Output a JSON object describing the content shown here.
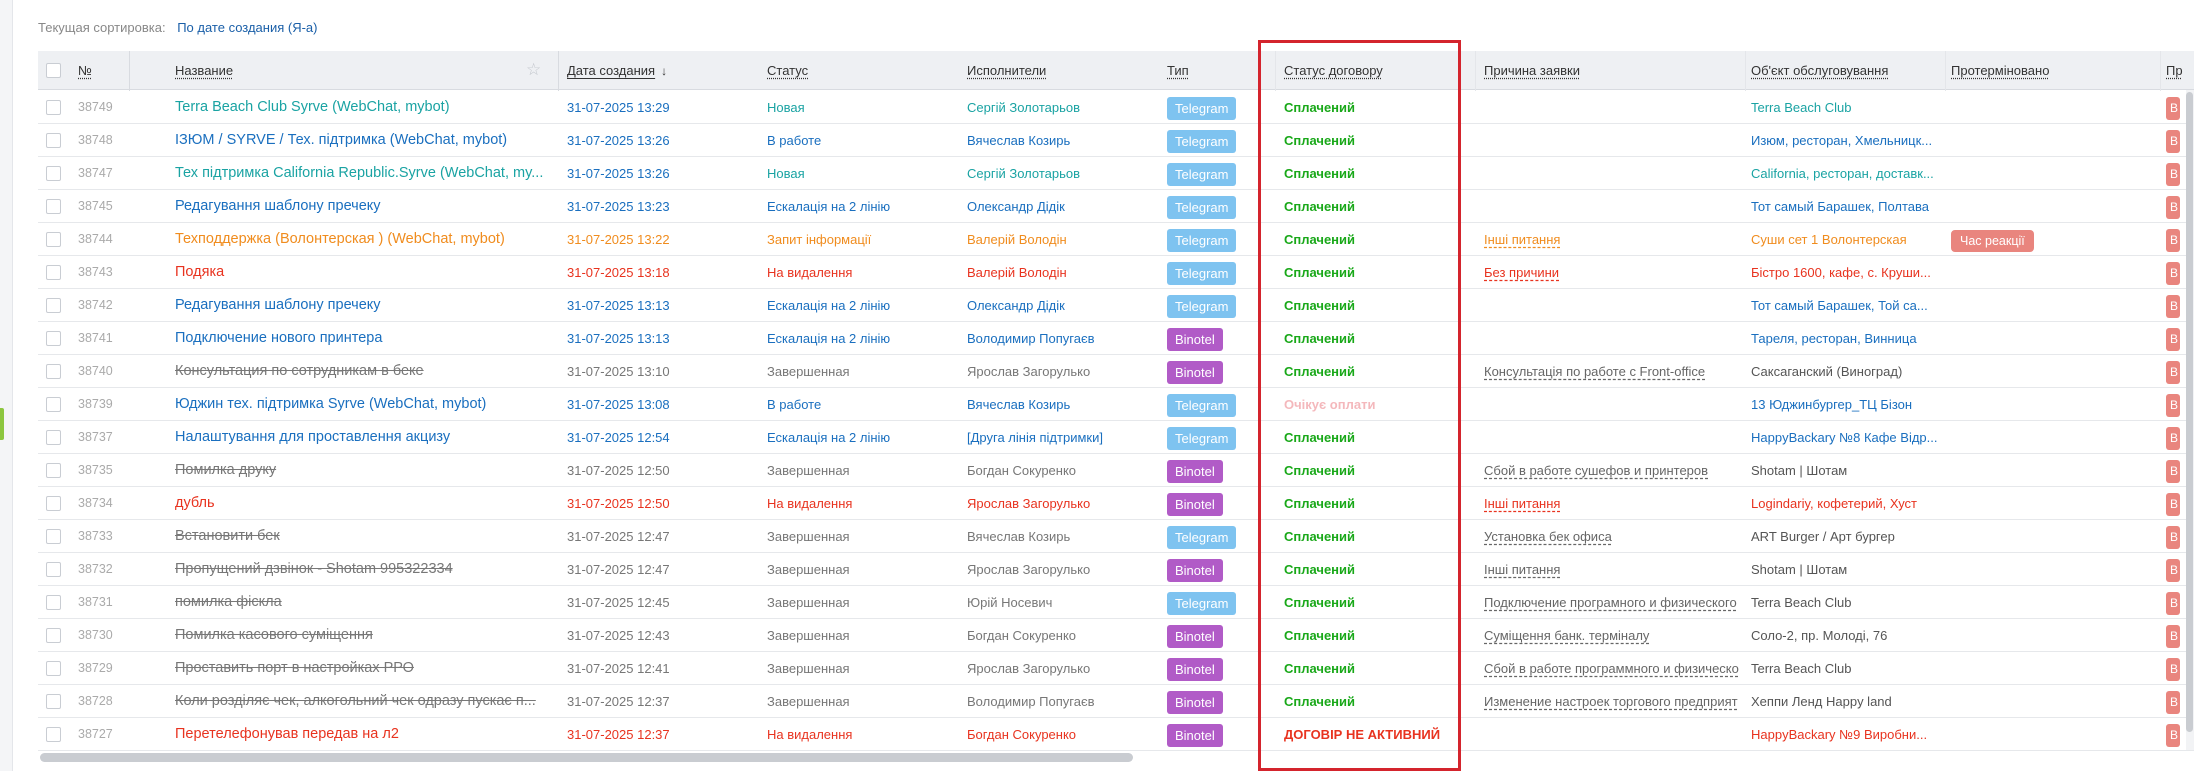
{
  "sort": {
    "label": "Текущая сортировка:",
    "value": "По дате создания (Я-а)"
  },
  "columns": {
    "num": "№",
    "title": "Название",
    "date": "Дата создания",
    "status": "Статус",
    "executors": "Исполнители",
    "type": "Тип",
    "contract": "Статус договору",
    "reason": "Причина заявки",
    "object": "Об'єкт обслуговування",
    "overdue": "Протерміновано",
    "extra": "Пр"
  },
  "colors": {
    "telegram": "#7ec3f0",
    "binotel": "#b15bc7",
    "green": "#19a819",
    "orange": "#f08c1e",
    "red": "#e8331f",
    "teal": "#1aa3a3",
    "blue": "#1a6fbf",
    "gray": "#777777",
    "pending": "#f4b8bc",
    "highlight": "#d4242d"
  },
  "rows": [
    {
      "num": "38749",
      "title": "Terra Beach Club Syrve (WebChat, mybot)",
      "date": "31-07-2025 13:29",
      "status": "Новая",
      "exec": "Сергій Золотарьов",
      "type": "Telegram",
      "contract": "Сплачений",
      "reason": "",
      "object": "Terra Beach Club",
      "overdue": "",
      "tone": "teal",
      "strike": false,
      "contractTone": "green"
    },
    {
      "num": "38748",
      "title": "ІЗЮМ / SYRVE / Тех. підтримка (WebChat, mybot)",
      "date": "31-07-2025 13:26",
      "status": "В работе",
      "exec": "Вячеслав Козирь",
      "type": "Telegram",
      "contract": "Сплачений",
      "reason": "",
      "object": "Изюм, ресторан, Хмельницк...",
      "overdue": "",
      "tone": "blue",
      "strike": false,
      "contractTone": "green"
    },
    {
      "num": "38747",
      "title": "Тех підтримка California Republic.Syrve (WebChat, my...",
      "date": "31-07-2025 13:26",
      "status": "Новая",
      "exec": "Сергій Золотарьов",
      "type": "Telegram",
      "contract": "Сплачений",
      "reason": "",
      "object": "California, ресторан, доставк...",
      "overdue": "",
      "tone": "teal",
      "strike": false,
      "contractTone": "green"
    },
    {
      "num": "38745",
      "title": "Редагування шаблону пречеку",
      "date": "31-07-2025 13:23",
      "status": "Ескалація на 2 лінію",
      "exec": "Олександр Дідік",
      "type": "Telegram",
      "contract": "Сплачений",
      "reason": "",
      "object": "Тот самый Барашек, Полтава",
      "overdue": "",
      "tone": "blue",
      "strike": false,
      "contractTone": "green"
    },
    {
      "num": "38744",
      "title": "Техподдержка (Волонтерская ) (WebChat, mybot)",
      "date": "31-07-2025 13:22",
      "status": "Запит інформації",
      "exec": "Валерій Володін",
      "type": "Telegram",
      "contract": "Сплачений",
      "reason": "Інші питання",
      "object": "Суши сет 1 Волонтерская",
      "overdue": "Час реакції",
      "tone": "orange",
      "strike": false,
      "contractTone": "green"
    },
    {
      "num": "38743",
      "title": "Подяка",
      "date": "31-07-2025 13:18",
      "status": "На видалення",
      "exec": "Валерій Володін",
      "type": "Telegram",
      "contract": "Сплачений",
      "reason": "Без причини",
      "object": "Бістро 1600, кафе, с. Круши...",
      "overdue": "",
      "tone": "red",
      "strike": false,
      "contractTone": "green"
    },
    {
      "num": "38742",
      "title": "Редагування шаблону пречеку",
      "date": "31-07-2025 13:13",
      "status": "Ескалація на 2 лінію",
      "exec": "Олександр Дідік",
      "type": "Telegram",
      "contract": "Сплачений",
      "reason": "",
      "object": "Тот самый Барашек, Той са...",
      "overdue": "",
      "tone": "blue",
      "strike": false,
      "contractTone": "green"
    },
    {
      "num": "38741",
      "title": "Подключение нового принтера",
      "date": "31-07-2025 13:13",
      "status": "Ескалація на 2 лінію",
      "exec": "Володимир Попугаєв",
      "type": "Binotel",
      "contract": "Сплачений",
      "reason": "",
      "object": "Тареля, ресторан, Винница",
      "overdue": "",
      "tone": "blue",
      "strike": false,
      "contractTone": "green"
    },
    {
      "num": "38740",
      "title": "Консультация по сотрудникам в беке",
      "date": "31-07-2025 13:10",
      "status": "Завершенная",
      "exec": "Ярослав Загорулько",
      "type": "Binotel",
      "contract": "Сплачений",
      "reason": "Консультація по работе с Front-office",
      "object": "Саксаганский (Виноград)",
      "overdue": "",
      "tone": "gray",
      "strike": true,
      "contractTone": "green"
    },
    {
      "num": "38739",
      "title": "Юджин тех. підтримка Syrve (WebChat, mybot)",
      "date": "31-07-2025 13:08",
      "status": "В работе",
      "exec": "Вячеслав Козирь",
      "type": "Telegram",
      "contract": "Очікує оплати",
      "reason": "",
      "object": "13 Юджинбургер_ТЦ Бізон",
      "overdue": "",
      "tone": "blue",
      "strike": false,
      "contractTone": "pending"
    },
    {
      "num": "38737",
      "title": "Налаштування для проставлення акцизу",
      "date": "31-07-2025 12:54",
      "status": "Ескалація на 2 лінію",
      "exec": "[Друга лінія підтримки]",
      "type": "Telegram",
      "contract": "Сплачений",
      "reason": "",
      "object": "HappyBackary №8 Кафе Відр...",
      "overdue": "",
      "tone": "blue",
      "strike": false,
      "contractTone": "green"
    },
    {
      "num": "38735",
      "title": "Помилка друку",
      "date": "31-07-2025 12:50",
      "status": "Завершенная",
      "exec": "Богдан Сокуренко",
      "type": "Binotel",
      "contract": "Сплачений",
      "reason": "Сбой в работе сушефов и принтеров",
      "object": "Shotam | Шотам",
      "overdue": "",
      "tone": "gray",
      "strike": true,
      "contractTone": "green"
    },
    {
      "num": "38734",
      "title": "дубль",
      "date": "31-07-2025 12:50",
      "status": "На видалення",
      "exec": "Ярослав Загорулько",
      "type": "Binotel",
      "contract": "Сплачений",
      "reason": "Інші питання",
      "object": "Logindariy, кофетерий, Хуст",
      "overdue": "",
      "tone": "red",
      "strike": false,
      "contractTone": "green"
    },
    {
      "num": "38733",
      "title": "Встановити бек",
      "date": "31-07-2025 12:47",
      "status": "Завершенная",
      "exec": "Вячеслав Козирь",
      "type": "Telegram",
      "contract": "Сплачений",
      "reason": "Установка бек офиса",
      "object": "ART Burger / Арт бургер",
      "overdue": "",
      "tone": "gray",
      "strike": true,
      "contractTone": "green"
    },
    {
      "num": "38732",
      "title": "Пропущений дзвінок - Shotam 995322334",
      "date": "31-07-2025 12:47",
      "status": "Завершенная",
      "exec": "Ярослав Загорулько",
      "type": "Binotel",
      "contract": "Сплачений",
      "reason": "Інші питання",
      "object": "Shotam | Шотам",
      "overdue": "",
      "tone": "gray",
      "strike": true,
      "contractTone": "green"
    },
    {
      "num": "38731",
      "title": "помилка фіскла",
      "date": "31-07-2025 12:45",
      "status": "Завершенная",
      "exec": "Юрій Носевич",
      "type": "Telegram",
      "contract": "Сплачений",
      "reason": "Подключение програмного и физического",
      "object": "Terra Beach Club",
      "overdue": "",
      "tone": "gray",
      "strike": true,
      "contractTone": "green"
    },
    {
      "num": "38730",
      "title": "Помилка касового суміщення",
      "date": "31-07-2025 12:43",
      "status": "Завершенная",
      "exec": "Богдан Сокуренко",
      "type": "Binotel",
      "contract": "Сплачений",
      "reason": "Суміщення банк. терміналу",
      "object": "Соло-2, пр. Молоді, 76",
      "overdue": "",
      "tone": "gray",
      "strike": true,
      "contractTone": "green"
    },
    {
      "num": "38729",
      "title": "Проставить порт в настройках РРО",
      "date": "31-07-2025 12:41",
      "status": "Завершенная",
      "exec": "Ярослав Загорулько",
      "type": "Binotel",
      "contract": "Сплачений",
      "reason": "Сбой в работе программного и физическо",
      "object": "Terra Beach Club",
      "overdue": "",
      "tone": "gray",
      "strike": true,
      "contractTone": "green"
    },
    {
      "num": "38728",
      "title": "Коли розділяє чек, алкогольний чек одразу пускає п...",
      "date": "31-07-2025 12:37",
      "status": "Завершенная",
      "exec": "Володимир Попугаєв",
      "type": "Binotel",
      "contract": "Сплачений",
      "reason": "Изменение настроек торгового предприят",
      "object": "Хеппи Ленд Happy land",
      "overdue": "",
      "tone": "gray",
      "strike": true,
      "contractTone": "green"
    },
    {
      "num": "38727",
      "title": "Перетелефонував передав на л2",
      "date": "31-07-2025 12:37",
      "status": "На видалення",
      "exec": "Богдан Сокуренко",
      "type": "Binotel",
      "contract": "ДОГОВІР НЕ АКТИВНИЙ",
      "reason": "",
      "object": "HappyBackary №9 Виробни...",
      "overdue": "",
      "tone": "red",
      "strike": false,
      "contractTone": "red"
    }
  ]
}
